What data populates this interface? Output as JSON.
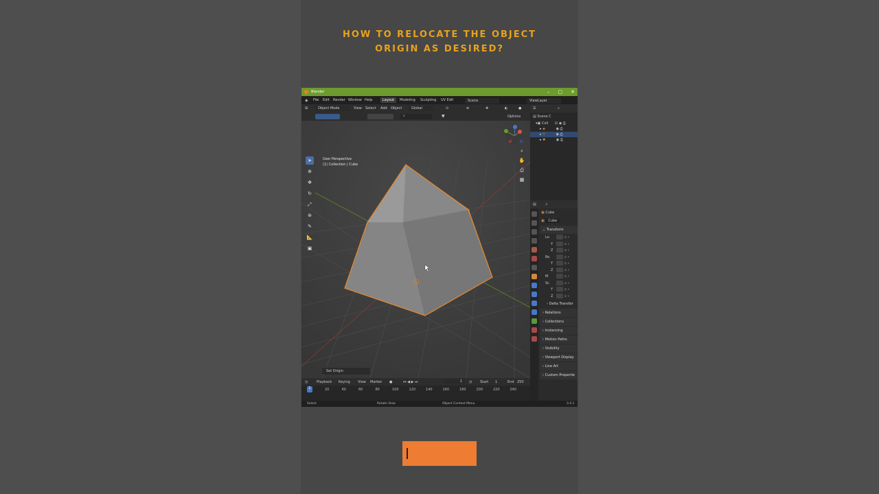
{
  "headline": {
    "line1": "HOW TO RELOCATE THE OBJECT",
    "line2": "ORIGIN AS DESIRED?"
  },
  "window": {
    "title": "Blender",
    "buttons": [
      "–",
      "▢",
      "✕"
    ]
  },
  "menubar": {
    "items": [
      "File",
      "Edit",
      "Render",
      "Window",
      "Help"
    ],
    "workspace_tabs": [
      "Layout",
      "Modeling",
      "Sculpting",
      "UV Edit"
    ],
    "active_workspace": "Layout",
    "scene": "Scene",
    "view_layer": "ViewLayer"
  },
  "viewport_header": {
    "mode": "Object Mode",
    "menus": [
      "View",
      "Select",
      "Add",
      "Object"
    ],
    "orientation": "Global",
    "options": "Options"
  },
  "viewport": {
    "perspective": "User Perspective",
    "collection": "(1) Collection | Cube",
    "last_operator": "Set Origin"
  },
  "outliner": {
    "root": "Scene C",
    "collection": "Coll"
  },
  "properties": {
    "object_name": "Cube",
    "data_name": "Cube",
    "transform_header": "Transform",
    "rows": [
      {
        "label": "Lo",
        "axis": ""
      },
      {
        "label": "",
        "axis": "Y"
      },
      {
        "label": "",
        "axis": "Z"
      },
      {
        "label": "Ro",
        "axis": ""
      },
      {
        "label": "",
        "axis": "Y"
      },
      {
        "label": "",
        "axis": "Z"
      },
      {
        "label": "M",
        "axis": ""
      },
      {
        "label": "Sc",
        "axis": ""
      },
      {
        "label": "",
        "axis": "Y"
      },
      {
        "label": "",
        "axis": "Z"
      }
    ],
    "panels": [
      "Delta Transfor",
      "Relations",
      "Collections",
      "Instancing",
      "Motion Paths",
      "Visibility",
      "Viewport Display",
      "Line Art",
      "Custom Propertie"
    ]
  },
  "timeline": {
    "menus": [
      "Playback",
      "Keying",
      "View",
      "Marker"
    ],
    "current_frame": "1",
    "start_label": "Start",
    "start": "1",
    "end_label": "End",
    "end": "250",
    "ticks": [
      "20",
      "40",
      "60",
      "80",
      "100",
      "120",
      "140",
      "160",
      "180",
      "200",
      "220",
      "240"
    ],
    "playhead": "1"
  },
  "statusbar": {
    "select": "Select",
    "rotate": "Rotate View",
    "context": "Object Context Menu",
    "version": "3.4.1"
  },
  "colors": {
    "title_accent": "#e8a21d",
    "titlebar": "#6e9b2d",
    "selection_outline": "#e88a2a",
    "cta_button": "#ee7c32"
  }
}
